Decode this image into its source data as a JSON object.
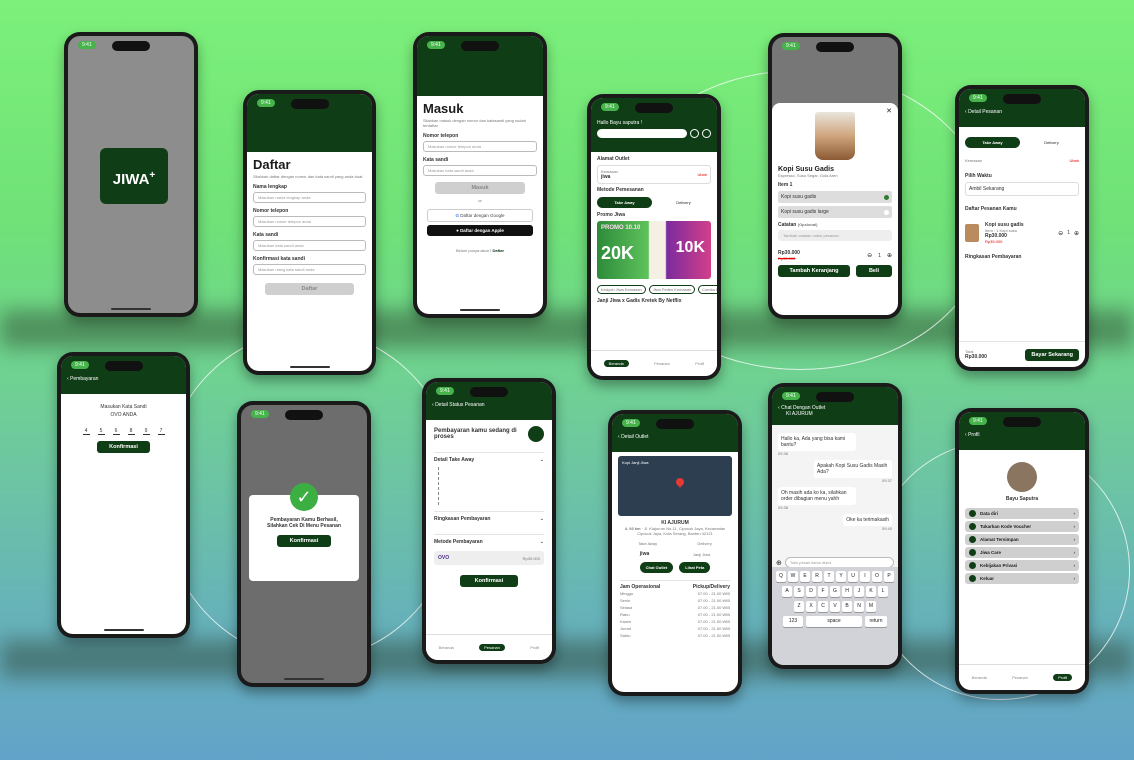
{
  "splash": {
    "time": "9:41",
    "logo": "JIWA",
    "plus": "+"
  },
  "register": {
    "time": "9:41",
    "title": "Daftar",
    "subtitle": "Silahkan daftar dengan nomor dan kata sandi yang anda buat",
    "fields": [
      {
        "label": "Nama lengkap",
        "ph": "Masukan nama lengkap anda"
      },
      {
        "label": "Nomor telepon",
        "ph": "Masukan nomor telepon anda"
      },
      {
        "label": "Kata sandi",
        "ph": "Masukan kata sandi anda"
      },
      {
        "label": "Konfirmasi kata sandi",
        "ph": "Masukan ulang kata sandi anda"
      }
    ],
    "button": "Daftar"
  },
  "login": {
    "time": "9:41",
    "title": "Masuk",
    "subtitle": "Silahkan masuk dengan nomor dan katasandi yang sudah terdaftar",
    "fields": [
      {
        "label": "Nomor telepon",
        "ph": "Masukan nomor telepon anda"
      },
      {
        "label": "Kata sandi",
        "ph": "Masukan kata sandi anda"
      }
    ],
    "button": "Masuk",
    "or": "or",
    "google": "Daftar dengan Google",
    "apple": "Daftar dengan Apple",
    "footer": "Belum punya akun?",
    "footer_link": "Daftar"
  },
  "home": {
    "time": "9:41",
    "greeting": "Hallo Bayu saputra !",
    "outlet_label": "Alamat Outlet",
    "outlet_name": "Kemasan",
    "outlet_brand": "jiwa",
    "outlet_action": "Ubah",
    "method_label": "Metode Pemesanan",
    "takeaway": "Take Away",
    "delivery": "Delivery",
    "promo_label": "Promo Jiwa",
    "promo_big": "20K",
    "promo_text": "PROMO 10.10",
    "promo_right": "10K",
    "chips": [
      "Kedyoh Jiwa Kemasan",
      "Jiwa Pedes Kemasan",
      "Combo Kemasan"
    ],
    "section": "Janji Jiwa x Gadis Kretek By Netflix",
    "nav": [
      "Beranda",
      "Pesanan",
      "Profil"
    ]
  },
  "product": {
    "time": "9:41",
    "name": "Kopi Susu Gadis",
    "desc": "Espresso, Susu Segar, Gula Aren",
    "item_label": "Item 1",
    "options": [
      "Kopi susu gadis",
      "Kopi susu gadis large"
    ],
    "note_label": "Catatan",
    "note_opt": "(Opsional)",
    "note_ph": "Tambah catatan untuk pesanan",
    "price": "Rp30.000",
    "old": "Rp35.000",
    "qty": "1",
    "add": "Tambah Keranjang",
    "buy": "Beli"
  },
  "order": {
    "time": "9:41",
    "title": "Detail Pesanan",
    "takeaway": "Take Away",
    "delivery": "Delivery",
    "outlet": "Kemasan",
    "outlet_action": "Ubah",
    "time_label": "Pilih Waktu",
    "time_value": "Ambil Sekarang",
    "list_label": "Daftar Pesanan Kamu",
    "item_name": "Kopi susu gadis",
    "item_sub": "Item : 1 Kopi susu",
    "item_price": "Rp30.000",
    "item_old": "Rp35.000",
    "qty": "1",
    "summary": "Ringkasan Pembayaran",
    "total_label": "Total",
    "total": "Rp30.000",
    "pay": "Bayar Sekarang"
  },
  "pin": {
    "time": "9:41",
    "title": "Pembayaran",
    "label": "Masukan Kata Sandi",
    "wallet": "OVO ANDA",
    "digits": [
      "4",
      "5",
      "6",
      "8",
      "9",
      "7"
    ],
    "button": "Konfirmasi"
  },
  "success": {
    "time": "9:41",
    "msg1": "Pembayaran Kamu Berhasil,",
    "msg2": "Silahkan Cek Di Menu Pesanan",
    "button": "Konfirmasi"
  },
  "status": {
    "time": "9:41",
    "title": "Detail Status Pesanan",
    "heading": "Pembayaran kamu sedang di proses",
    "takeaway": "Detail Take Away",
    "summary": "Ringkasan Pembayaran",
    "method": "Metode Pembayaran",
    "wallet": "OVO",
    "wallet_price": "Rp30.000",
    "button": "Konfirmasi",
    "nav": [
      "Beranda",
      "Pesanan",
      "Profil"
    ]
  },
  "outlet": {
    "time": "9:41",
    "title": "Detail Outlet",
    "map_label": "Kopi Janji Jiwa",
    "name": "KI AJURUM",
    "distance": "4. 93 km",
    "address": "Jl. Kiajurum No.11, Cipocok Jaya, Kecamatan Cipocok Jaya, Kota Serang, Banten 42121",
    "takeaway": "Take Away",
    "delivery": "Delivery",
    "brand": "jiwa",
    "brand2": "Janji Jiwa",
    "chat": "Chat Outlet",
    "map": "Lihat Peta",
    "hours_label": "Jam Operasional",
    "type_label": "Pickup/Delivery",
    "days": [
      "Minggu",
      "Senin",
      "Selasa",
      "Rabu",
      "Kamis",
      "Jumat",
      "Sabtu"
    ],
    "hours": "07.00 - 21.00 WIB"
  },
  "chat": {
    "time": "9:41",
    "title": "Chat Dengan Outlet",
    "subtitle": "KI AJURUM",
    "msgs": [
      {
        "side": "l",
        "text": "Hallo ka, Ada yang bisa kami bantu?",
        "time": "09.36"
      },
      {
        "side": "r",
        "text": "Apakah Kopi Susu Gadis Masih Ada?",
        "time": "09.37"
      },
      {
        "side": "l",
        "text": "Oh masih ada ko ka, silahkan order dibagian menu yahh",
        "time": "09.38"
      },
      {
        "side": "r",
        "text": "Oke ka terimakasih",
        "time": "09.40"
      }
    ],
    "input_ph": "Tulis pesan kamu disini",
    "keys1": [
      "Q",
      "W",
      "E",
      "R",
      "T",
      "Y",
      "U",
      "I",
      "O",
      "P"
    ],
    "keys2": [
      "A",
      "S",
      "D",
      "F",
      "G",
      "H",
      "J",
      "K",
      "L"
    ],
    "keys3": [
      "Z",
      "X",
      "C",
      "V",
      "B",
      "N",
      "M"
    ],
    "k123": "123",
    "space": "space",
    "ret": "return"
  },
  "profile": {
    "time": "9:41",
    "title": "Profil",
    "name": "Bayu Saputra",
    "items": [
      "Data diri",
      "Tukarkan Kode Voucher",
      "Alamat Tersimpan",
      "Jiwa Care",
      "Kebijakan Privasi",
      "Keluar"
    ],
    "nav": [
      "Beranda",
      "Pesanan",
      "Profil"
    ]
  }
}
